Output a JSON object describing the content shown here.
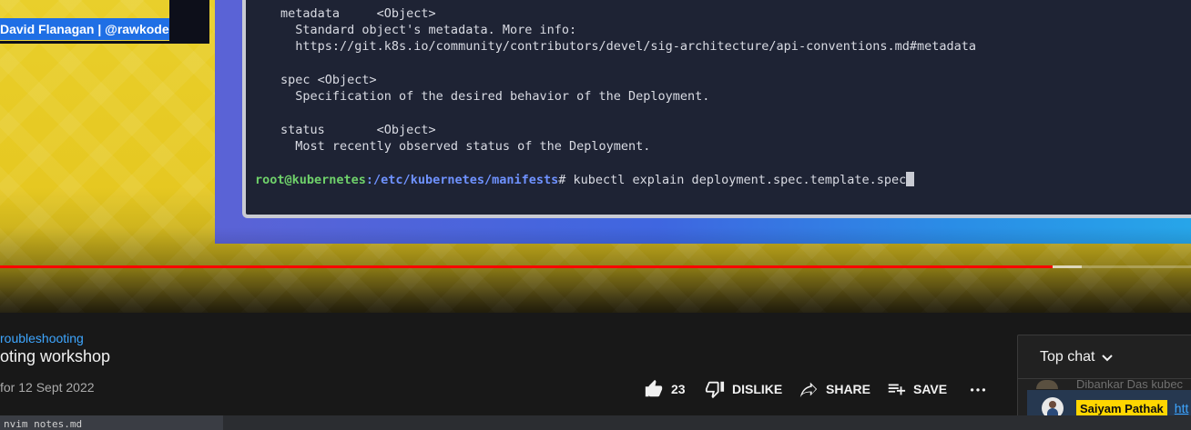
{
  "video": {
    "name_tag": "David Flanagan | @rawkode",
    "terminal": {
      "lines": [
        "metadata     <Object>",
        "  Standard object's metadata. More info:",
        "  https://git.k8s.io/community/contributors/devel/sig-architecture/api-conventions.md#metadata",
        "",
        "spec <Object>",
        "  Specification of the desired behavior of the Deployment.",
        "",
        "status       <Object>",
        "  Most recently observed status of the Deployment."
      ],
      "prompt_user": "root@kubernetes",
      "prompt_path": ":/etc/kubernetes/manifests",
      "prompt_symbol": "#",
      "command": " kubectl explain deployment.spec.template.spec"
    },
    "progress_played": 0.884,
    "progress_loaded": 0.908
  },
  "info": {
    "hashtag": "roubleshooting",
    "title": "oting workshop",
    "date": "for 12 Sept 2022"
  },
  "actions": {
    "like_count": "23",
    "dislike_label": "DISLIKE",
    "share_label": "SHARE",
    "save_label": "SAVE"
  },
  "chat": {
    "header": "Top chat",
    "faded_message": "Dibankar Das  kubec",
    "pinned_author": "Saiyam Pathak",
    "pinned_link": "htt"
  },
  "bottom_tab": "nvim notes.md",
  "colors": {
    "accent_red": "#ff0000",
    "link_blue": "#3ea6ff",
    "highlight_yellow": "#ffd600"
  }
}
